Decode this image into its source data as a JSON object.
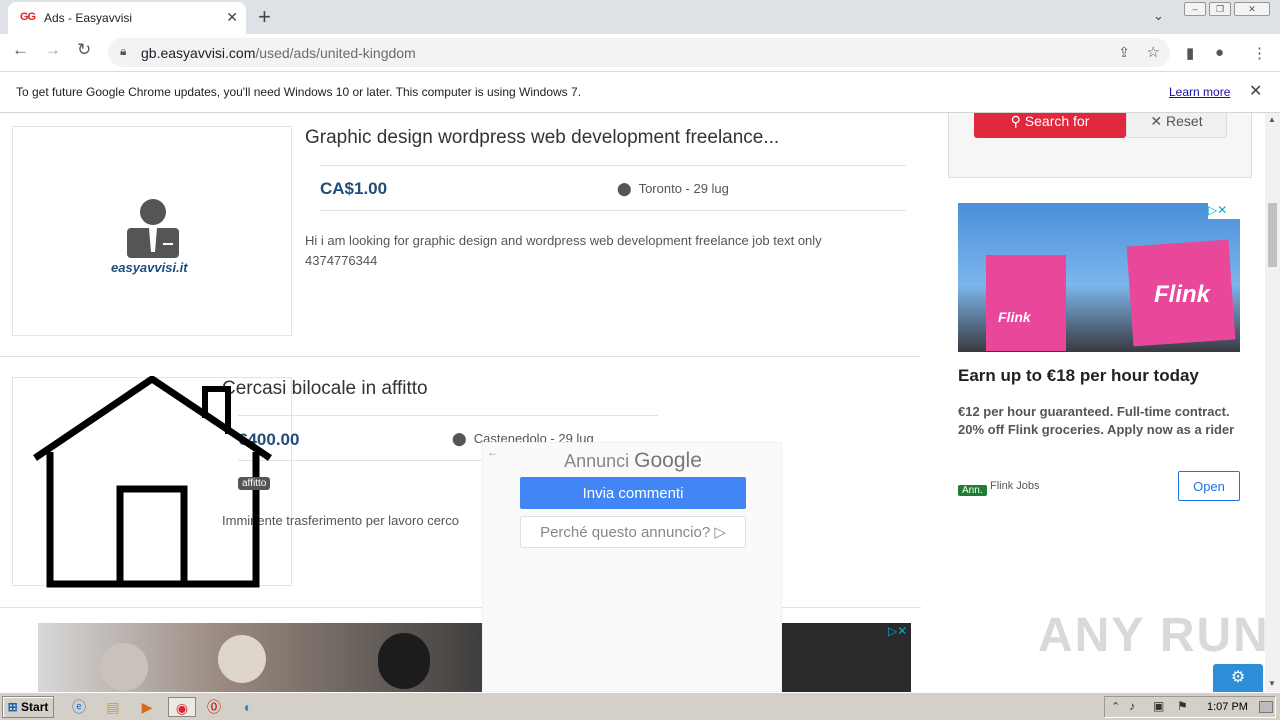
{
  "browser": {
    "tab_title": "Ads - Easyavvisi",
    "tab_favicon": "GG",
    "new_tab": "+",
    "url_host": "gb.easyavvisi.com",
    "url_path": "/used/ads/united-kingdom"
  },
  "infobar": {
    "message": "To get future Google Chrome updates, you'll need Windows 10 or later. This computer is using Windows 7.",
    "learn_more": "Learn more"
  },
  "search_panel": {
    "search_label": "Search for",
    "reset_label": "Reset"
  },
  "listings": [
    {
      "title": "Graphic design wordpress web development freelance...",
      "price": "CA$1.00",
      "location": "Toronto - 29 lug",
      "description": "Hi i am looking for graphic design and wordpress web development freelance job text only 4374776344",
      "image_logo": "easyavvisi.it"
    },
    {
      "title": "Cercasi bilocale in affitto",
      "price": "€400.00",
      "location": "Castenedolo - 29 lug",
      "description": "Imminente trasferimento per lavoro  cerco",
      "image_tag": "affitto"
    }
  ],
  "google_feedback": {
    "label_prefix": "Annunci",
    "label_brand": "Google",
    "send_feedback": "Invia commenti",
    "why_this_ad": "Perché questo annuncio?"
  },
  "right_ad": {
    "headline": "Earn up to €18 per hour today",
    "body": "€12 per hour guaranteed. Full-time contract. 20% off Flink groceries. Apply now as a rider",
    "badge": "Ann.",
    "advertiser": "Flink Jobs",
    "cta": "Open",
    "brand_text": "Flink"
  },
  "watermark": "ANY RUN",
  "taskbar": {
    "start": "Start",
    "clock": "1:07 PM"
  },
  "colors": {
    "accent_red": "#e0283e",
    "price_blue": "#1e4e7a",
    "google_blue": "#4285f4"
  }
}
